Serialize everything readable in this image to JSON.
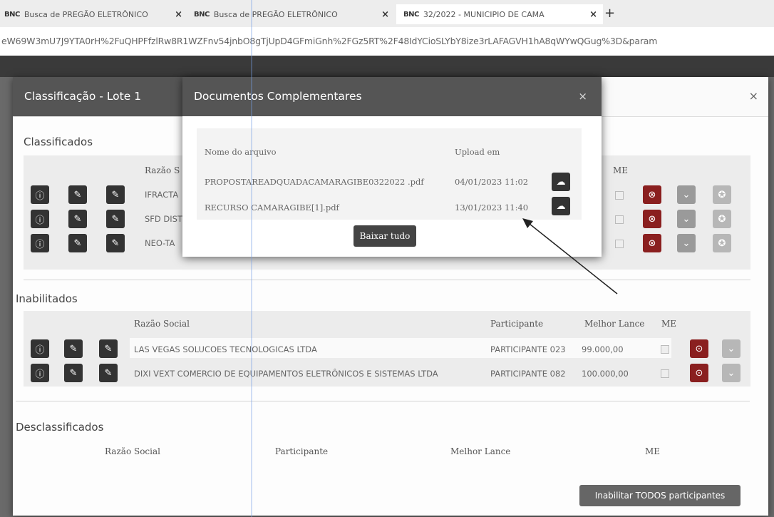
{
  "tabs": [
    {
      "favicon": "BNC",
      "label": "Busca de PREGÃO ELETRÔNICO",
      "close": "×"
    },
    {
      "favicon": "BNC",
      "label": "Busca de PREGÃO ELETRÔNICO",
      "close": "×"
    },
    {
      "favicon": "BNC",
      "label": "32/2022 - MUNICIPIO DE CAMA",
      "close": "×"
    }
  ],
  "new_tab": "+",
  "url": "eW69W3mU7J9YTA0rH%2FuQHPFfzlRw8R1WZFnv54jnbO8gTjUpD4GFmiGnh%2FGz5RT%2F48IdYCioSLYbY8ize3rLAFAGVH1hA8qWYwQGug%3D&param",
  "modal1": {
    "title": "Classificação - Lote 1",
    "close": "×",
    "classificados": {
      "title": "Classificados",
      "col_razao": "Razão S",
      "col_me": "ME",
      "rows": [
        {
          "razao": "IFRACTA"
        },
        {
          "razao": "SFD DIST"
        },
        {
          "razao": "NEO-TA"
        }
      ]
    },
    "inabilitados": {
      "title": "Inabilitados",
      "col_razao": "Razão Social",
      "col_participante": "Participante",
      "col_lance": "Melhor Lance",
      "col_me": "ME",
      "rows": [
        {
          "razao": "LAS VEGAS SOLUCOES TECNOLOGICAS LTDA",
          "participante": "PARTICIPANTE 023",
          "lance": "99.000,00"
        },
        {
          "razao": "DIXI VEXT COMERCIO DE EQUIPAMENTOS ELETRÔNICOS E SISTEMAS LTDA",
          "participante": "PARTICIPANTE 082",
          "lance": "100.000,00"
        }
      ]
    },
    "desclassificados": {
      "title": "Desclassificados",
      "col_razao": "Razão Social",
      "col_participante": "Participante",
      "col_lance": "Melhor Lance",
      "col_me": "ME"
    },
    "habilitar_button": "Inabilitar TODOS participantes"
  },
  "modal2": {
    "title": "Documentos Complementares",
    "close": "×",
    "col_nome": "Nome do arquivo",
    "col_upload": "Upload em",
    "files": [
      {
        "name": "PROPOSTAREADQUADACAMARAGIBE0322022 .pdf",
        "date": "04/01/2023 11:02"
      },
      {
        "name": "RECURSO CAMARAGIBE[1].pdf",
        "date": "13/01/2023 11:40"
      }
    ],
    "baixar_button": "Baixar tudo"
  }
}
